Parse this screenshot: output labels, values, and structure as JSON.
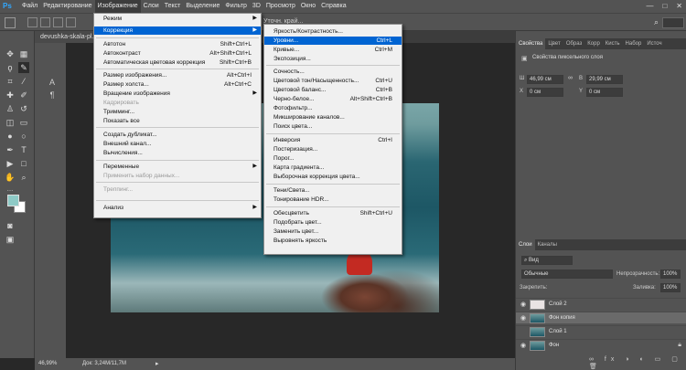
{
  "menubar": {
    "logo": "Ps",
    "items": [
      "Файл",
      "Редактирование",
      "Изображение",
      "Слои",
      "Текст",
      "Выделение",
      "Фильтр",
      "3D",
      "Просмотр",
      "Окно",
      "Справка"
    ],
    "active_index": 2,
    "window_controls": [
      "—",
      "□",
      "✕"
    ]
  },
  "optbar": {
    "refine_label": "Уточн. край..."
  },
  "document": {
    "tab_title": "devushka-skala-pl...",
    "zoom": "46,99%",
    "doc_info": "Док: 3,24М/11,7М"
  },
  "image_menu": {
    "items": [
      {
        "label": "Режим",
        "shortcut": "",
        "submenu": true
      },
      {
        "label": "Коррекция",
        "shortcut": "",
        "submenu": true,
        "highlighted": true
      },
      {
        "label": "Автотон",
        "shortcut": "Shift+Ctrl+L"
      },
      {
        "label": "Автоконтраст",
        "shortcut": "Alt+Shift+Ctrl+L"
      },
      {
        "label": "Автоматическая цветовая коррекция",
        "shortcut": "Shift+Ctrl+B"
      },
      {
        "label": "Размер изображения...",
        "shortcut": "Alt+Ctrl+I"
      },
      {
        "label": "Размер холста...",
        "shortcut": "Alt+Ctrl+C"
      },
      {
        "label": "Вращение изображения",
        "shortcut": "",
        "submenu": true
      },
      {
        "label": "Кадрировать",
        "shortcut": "",
        "disabled": true
      },
      {
        "label": "Тримминг...",
        "shortcut": ""
      },
      {
        "label": "Показать все",
        "shortcut": ""
      },
      {
        "label": "Создать дубликат...",
        "shortcut": ""
      },
      {
        "label": "Внешний канал...",
        "shortcut": ""
      },
      {
        "label": "Вычисления...",
        "shortcut": ""
      },
      {
        "label": "Переменные",
        "shortcut": "",
        "submenu": true
      },
      {
        "label": "Применить набор данных...",
        "shortcut": "",
        "disabled": true
      },
      {
        "label": "Треппинг...",
        "shortcut": "",
        "disabled": true
      },
      {
        "label": "Анализ",
        "shortcut": "",
        "submenu": true
      }
    ]
  },
  "correction_menu": {
    "items": [
      {
        "label": "Яркость/Контрастность...",
        "shortcut": ""
      },
      {
        "label": "Уровни...",
        "shortcut": "Ctrl+L",
        "highlighted": true
      },
      {
        "label": "Кривые...",
        "shortcut": "Ctrl+M"
      },
      {
        "label": "Экспозиция...",
        "shortcut": ""
      },
      {
        "label": "Сочность...",
        "shortcut": ""
      },
      {
        "label": "Цветовой тон/Насыщенность...",
        "shortcut": "Ctrl+U"
      },
      {
        "label": "Цветовой баланс...",
        "shortcut": "Ctrl+B"
      },
      {
        "label": "Черно-белое...",
        "shortcut": "Alt+Shift+Ctrl+B"
      },
      {
        "label": "Фотофильтр...",
        "shortcut": ""
      },
      {
        "label": "Микширование каналов...",
        "shortcut": ""
      },
      {
        "label": "Поиск цвета...",
        "shortcut": ""
      },
      {
        "label": "Инверсия",
        "shortcut": "Ctrl+I"
      },
      {
        "label": "Постеризация...",
        "shortcut": ""
      },
      {
        "label": "Порог...",
        "shortcut": ""
      },
      {
        "label": "Карта градиента...",
        "shortcut": ""
      },
      {
        "label": "Выборочная коррекция цвета...",
        "shortcut": ""
      },
      {
        "label": "Тени/Света...",
        "shortcut": ""
      },
      {
        "label": "Тонирование HDR...",
        "shortcut": ""
      },
      {
        "label": "Обесцветить",
        "shortcut": "Shift+Ctrl+U"
      },
      {
        "label": "Подобрать цвет...",
        "shortcut": ""
      },
      {
        "label": "Заменить цвет...",
        "shortcut": ""
      },
      {
        "label": "Выровнять яркость",
        "shortcut": ""
      }
    ]
  },
  "properties_panel": {
    "tabs": [
      "Свойства",
      "Цвет",
      "Образ",
      "Корр",
      "Кисть",
      "Набор",
      "Источ"
    ],
    "title": "Свойства пиксельного слоя",
    "width_value": "46,99 см",
    "height_value": "29,99 см",
    "x_value": "0 см",
    "y_value": "0 см",
    "w_label": "Ш",
    "h_label": "В",
    "x_label": "X",
    "y_label": "Y"
  },
  "layers_panel": {
    "tabs": [
      "Слои",
      "Каналы"
    ],
    "filter_kind": "Вид",
    "blend_mode": "Обычные",
    "opacity_label": "Непрозрачность:",
    "opacity_value": "100%",
    "lock_label": "Закрепить:",
    "fill_label": "Заливка:",
    "fill_value": "100%",
    "layers": [
      {
        "name": "Слой 2",
        "visible": true
      },
      {
        "name": "Фон копия",
        "visible": true,
        "selected": true
      },
      {
        "name": "Слой 1",
        "visible": false
      },
      {
        "name": "Фон",
        "visible": true,
        "locked": true
      }
    ]
  }
}
